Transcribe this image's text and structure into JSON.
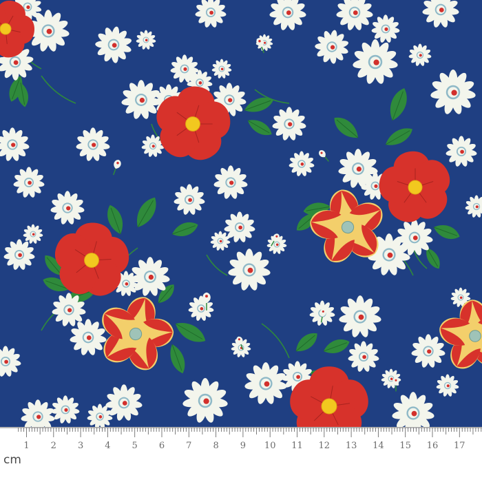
{
  "fabric": {
    "background_color": "#1f3f82",
    "colors": {
      "daisy_petal": "#f3f5ec",
      "daisy_center": "#d2302c",
      "daisy_ring": "#8fb9c7",
      "poppy_red": "#d7322b",
      "poppy_center": "#f2c81f",
      "yellow_petal": "#f3cf6b",
      "yellow_flame": "#d7322b",
      "yellow_center": "#9fc3b8",
      "leaf_green": "#2f8a3b",
      "leaf_dark": "#1f6a2b",
      "stem_green": "#2f8a3b"
    },
    "motifs": [
      "daisy-motif",
      "red-poppy-motif",
      "yellow-flame-flower-motif",
      "leaf-motif"
    ]
  },
  "ruler": {
    "unit": "cm",
    "numbers": [
      "1",
      "2",
      "3",
      "4",
      "5",
      "6",
      "7",
      "8",
      "9",
      "10",
      "11",
      "12",
      "13",
      "14",
      "15",
      "16",
      "17"
    ],
    "tick_color": "#6b6b6b",
    "background_color": "#ffffff"
  }
}
